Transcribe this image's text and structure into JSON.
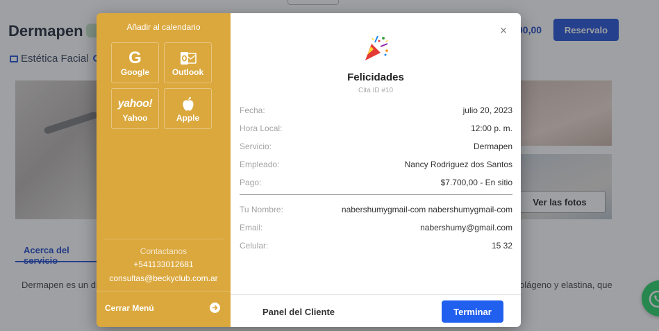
{
  "background": {
    "page_title": "Dermapen",
    "price_fragment": "00,00",
    "reserve_label": "Reservalo",
    "category": "Estética Facial",
    "see_photos_label": "Ver las fotos",
    "tab_label": "Acerca del servicio",
    "desc_left": "Dermapen es un dis",
    "desc_right": "olágeno y elastina, que"
  },
  "sidebar": {
    "title": "Añadir al calendario",
    "calendars": [
      {
        "label": "Google",
        "icon": "google-icon"
      },
      {
        "label": "Outlook",
        "icon": "outlook-icon"
      },
      {
        "label": "Yahoo",
        "icon": "yahoo-icon",
        "logo_text": "yahoo!"
      },
      {
        "label": "Apple",
        "icon": "apple-icon"
      }
    ],
    "contact_title": "Contactanos",
    "phone": "+541133012681",
    "email": "consultas@beckyclub.com.ar",
    "close_menu_label": "Cerrar Menú"
  },
  "modal": {
    "title": "Felicidades",
    "subtitle": "Cita ID #10",
    "details": [
      {
        "key": "Fecha:",
        "value": "julio 20, 2023"
      },
      {
        "key": "Hora Local:",
        "value": "12:00 p. m."
      },
      {
        "key": "Servicio:",
        "value": "Dermapen"
      },
      {
        "key": "Empleado:",
        "value": "Nancy Rodriguez dos Santos"
      },
      {
        "key": "Pago:",
        "value": "$7.700,00 - En sitio"
      }
    ],
    "customer": [
      {
        "key": "Tu Nombre:",
        "value": "nabershumygmail-com nabershumygmail-com"
      },
      {
        "key": "Email:",
        "value": "nabershumy@gmail.com"
      },
      {
        "key": "Celular:",
        "value": "15 32"
      }
    ],
    "panel_label": "Panel del Cliente",
    "finish_label": "Terminar",
    "close_icon": "close-icon"
  },
  "colors": {
    "sidebar_bg": "#dba83e",
    "primary_blue": "#2160ee",
    "overlay": "rgba(40,44,52,0.45)"
  }
}
